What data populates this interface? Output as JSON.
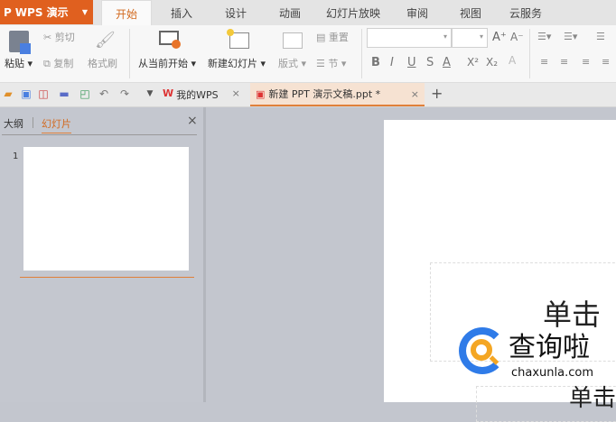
{
  "app": {
    "name": "WPS 演示",
    "brand_color": "#e0601f"
  },
  "tabs": [
    "开始",
    "插入",
    "设计",
    "动画",
    "幻灯片放映",
    "审阅",
    "视图",
    "云服务"
  ],
  "ribbon": {
    "paste": "粘贴",
    "cut": "剪切",
    "copy": "复制",
    "format_painter": "格式刷",
    "from_current": "从当前开始",
    "new_slide": "新建幻灯片",
    "layout": "版式",
    "reset": "重置",
    "section": "节",
    "bold": "B",
    "italic": "I",
    "underline": "U",
    "strike": "S",
    "font_color": "A",
    "superscript": "X²",
    "subscript": "X₂",
    "grow": "A⁺",
    "shrink": "A⁻"
  },
  "doc_tabs": [
    {
      "label": "我的WPS",
      "close": "×"
    },
    {
      "label": "新建 PPT 演示文稿.ppt *",
      "close": "×"
    }
  ],
  "new_tab": "+",
  "panel": {
    "outline": "大纲",
    "slides": "幻灯片",
    "close": "×",
    "slide_number": "1"
  },
  "slide": {
    "title_placeholder": "单击",
    "subtitle_placeholder": "单击"
  },
  "watermark": {
    "name": "查询啦",
    "url": "chaxunla.com"
  }
}
